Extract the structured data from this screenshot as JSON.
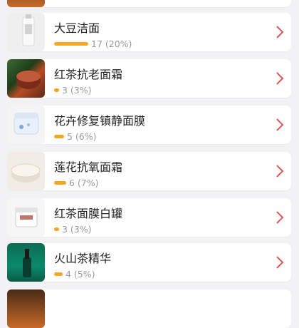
{
  "products": [
    {
      "name": "大豆洁面",
      "stat": "17 (20%)",
      "fraction": 0.2,
      "icon": "soy-cleanser-thumb"
    },
    {
      "name": "红茶抗老面霜",
      "stat": "3 (3%)",
      "fraction": 0.03,
      "icon": "black-tea-cream-thumb"
    },
    {
      "name": "花卉修复镇静面膜",
      "stat": "5 (6%)",
      "fraction": 0.06,
      "icon": "flower-mask-thumb"
    },
    {
      "name": "莲花抗氧面霜",
      "stat": "6 (7%)",
      "fraction": 0.07,
      "icon": "lotus-cream-thumb"
    },
    {
      "name": "红茶面膜白罐",
      "stat": "3 (3%)",
      "fraction": 0.03,
      "icon": "black-tea-mask-jar-thumb"
    },
    {
      "name": "火山茶精华",
      "stat": "4 (5%)",
      "fraction": 0.05,
      "icon": "volcano-tea-serum-thumb"
    }
  ],
  "colors": {
    "bar": "#f6a623",
    "chevron": "#e0585f"
  }
}
